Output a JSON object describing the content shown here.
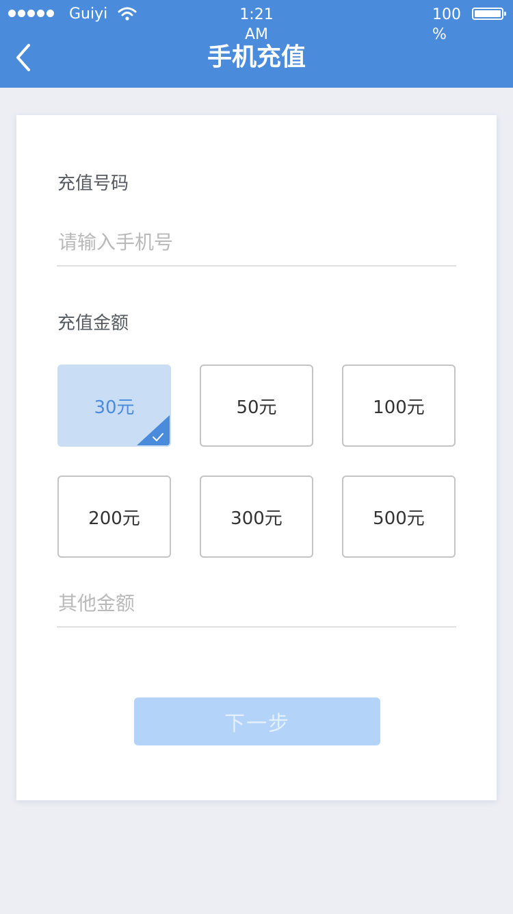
{
  "status_bar": {
    "carrier": "Guiyi",
    "time": "1:21\nAM",
    "battery": "100\n%"
  },
  "header": {
    "title": "手机充值"
  },
  "form": {
    "phone_label": "充值号码",
    "phone_placeholder": "请输入手机号",
    "amount_label": "充值金额",
    "amounts": [
      {
        "label": "30元",
        "selected": true
      },
      {
        "label": "50元",
        "selected": false
      },
      {
        "label": "100元",
        "selected": false
      },
      {
        "label": "200元",
        "selected": false
      },
      {
        "label": "300元",
        "selected": false
      },
      {
        "label": "500元",
        "selected": false
      }
    ],
    "other_amount_placeholder": "其他金额",
    "next_label": "下一步"
  },
  "colors": {
    "primary": "#4a8cdb",
    "selected_bg": "#c9ddf5",
    "button_disabled": "#b3d4f8",
    "page_bg": "#eceef4"
  }
}
